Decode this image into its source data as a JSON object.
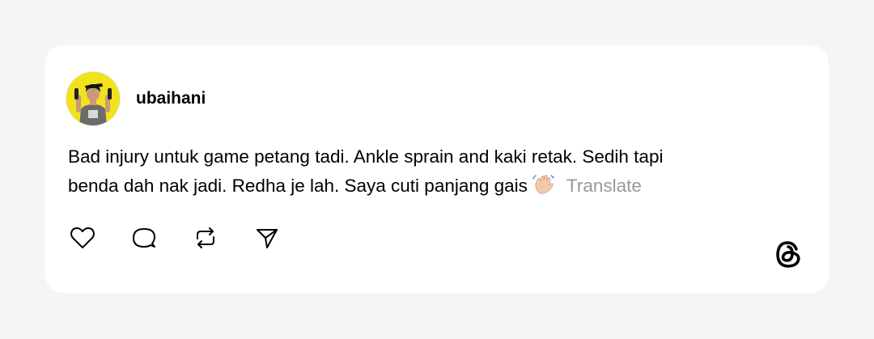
{
  "post": {
    "username": "ubaihani",
    "text_line1": "Bad injury untuk game petang tadi. Ankle sprain and kaki retak. Sedih tapi",
    "text_line2": "benda dah nak jadi. Redha je lah. Saya cuti panjang gais",
    "translate_label": "Translate"
  },
  "icons": {
    "emoji": "waving-hand-icon",
    "like": "heart-icon",
    "comment": "comment-bubble-icon",
    "repost": "repost-icon",
    "share": "send-icon",
    "brand": "threads-logo-icon"
  },
  "colors": {
    "page_background": "#f5f5f5",
    "card_background": "#ffffff",
    "avatar_background": "#f1e21e",
    "text": "#000000",
    "muted_text": "#999999"
  }
}
